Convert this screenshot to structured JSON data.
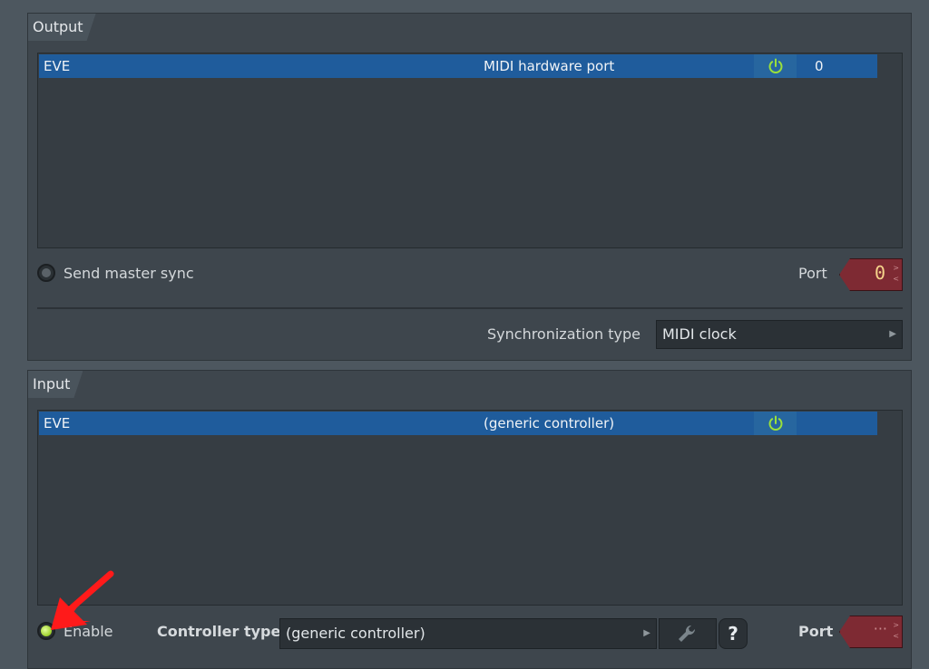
{
  "output": {
    "title": "Output",
    "row": {
      "name": "EVE",
      "type": "MIDI hardware port",
      "port": "0"
    },
    "send_master_sync_label": "Send master sync",
    "port_label": "Port",
    "port_value": "0",
    "sync_type_label": "Synchronization type",
    "sync_type_value": "MIDI clock"
  },
  "input": {
    "title": "Input",
    "row": {
      "name": "EVE",
      "type": "(generic controller)"
    },
    "enable_label": "Enable",
    "controller_type_label": "Controller type",
    "controller_type_value": "(generic controller)",
    "help_label": "?",
    "port_label": "Port",
    "port_value": "···"
  },
  "colors": {
    "selection": "#1f5c9c",
    "power_green": "#9be03a",
    "port_box": "#7e2a33",
    "annotation_arrow": "#ff1a1a"
  },
  "icons": {
    "power": "power-icon",
    "wrench": "wrench-icon",
    "chevron": "chevron-right-icon"
  }
}
